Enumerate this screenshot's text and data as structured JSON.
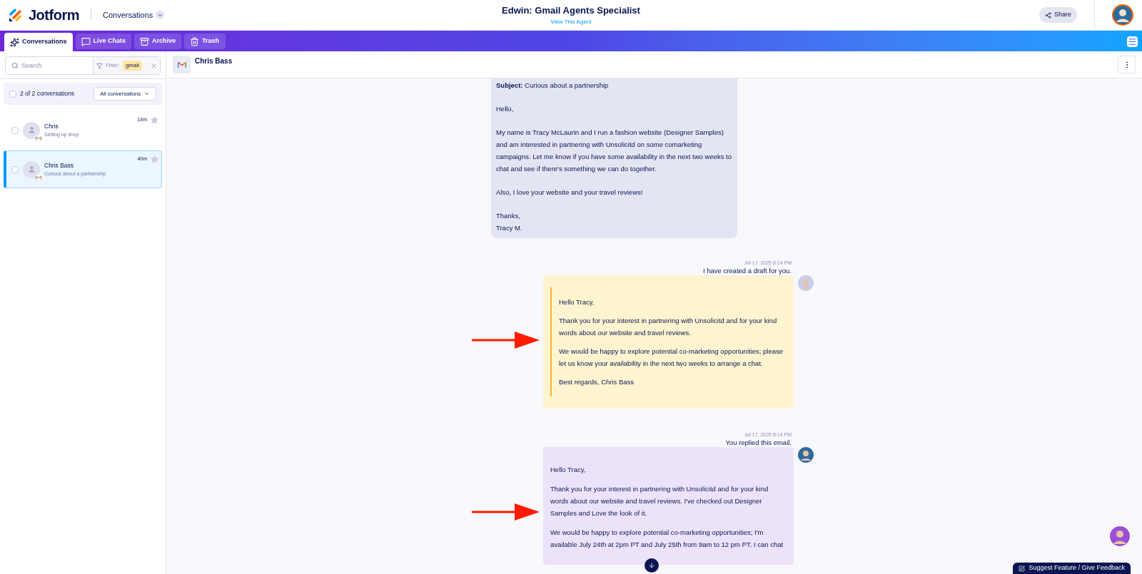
{
  "header": {
    "logo": "Jotform",
    "section": "Conversations",
    "title": "Edwin: Gmail Agents Specialist",
    "subtitle": "View This Agent",
    "share": "Share"
  },
  "tabs": [
    {
      "label": "Conversations",
      "kind": "sparkle",
      "selected": true
    },
    {
      "label": "Live Chats",
      "kind": "chat",
      "selected": false
    },
    {
      "label": "Archive",
      "kind": "archive",
      "selected": false
    },
    {
      "label": "Trash",
      "kind": "trash",
      "selected": false
    }
  ],
  "sidebar": {
    "search": {
      "placeholder": "Search"
    },
    "filter": {
      "label": "Filter:",
      "value": "gmail"
    },
    "summary": {
      "count": "2 of 2 conversations",
      "checked": false,
      "dropdown": "All conversations"
    },
    "conversations": [
      {
        "name": "Chris",
        "preview": "Setting up shop",
        "time": "14m",
        "checked": false,
        "starred": false,
        "selected": false
      },
      {
        "name": "Chris Bass",
        "preview": "Curious about a partnership",
        "time": "40m",
        "checked": false,
        "starred": false,
        "selected": true
      }
    ]
  },
  "conversation": {
    "contact": "Chris Bass",
    "messages": [
      {
        "kind": "inbound",
        "paragraphs": [
          "**Subject:** Curious about a partnership",
          "Hello,",
          "My name is Tracy McLaurin and I run a fashion website (Designer Samples) and am interested in partnering with Unsolicitd on some comarketing campaigns. Let me know if you have some availability in the next two weeks to chat and see if there's something we can do together.",
          "Also, I love your website and your travel reviews!",
          "Thanks,\nTracy M."
        ]
      },
      {
        "kind": "draft",
        "timestamp": "Jul 17, 2025 8:14 PM",
        "caption": "I have created a draft for you.",
        "paragraphs": [
          "Hello Tracy,",
          "Thank you for your interest in partnering with Unsolicitd and for your kind words about our website and travel reviews.",
          "We would be happy to explore potential co-marketing opportunities; please let us know your availability in the next two weeks to arrange a chat.",
          "Best regards, Chris Bass"
        ]
      },
      {
        "kind": "reply",
        "timestamp": "Jul 17, 2025 8:14 PM",
        "caption": "You replied this email.",
        "paragraphs": [
          "Hello Tracy,",
          "Thank you for your interest in partnering with Unsolicitd and for your kind words about our website and travel reviews. I've checked out Designer Samples and Love the look of it.",
          "We would be happy to explore potential co-marketing opportunities; I'm available July 24th at 2pm PT and July 25th from 9am to 12 pm PT. I can chat"
        ]
      }
    ]
  },
  "feedback": "Suggest Feature / Give Feedback"
}
